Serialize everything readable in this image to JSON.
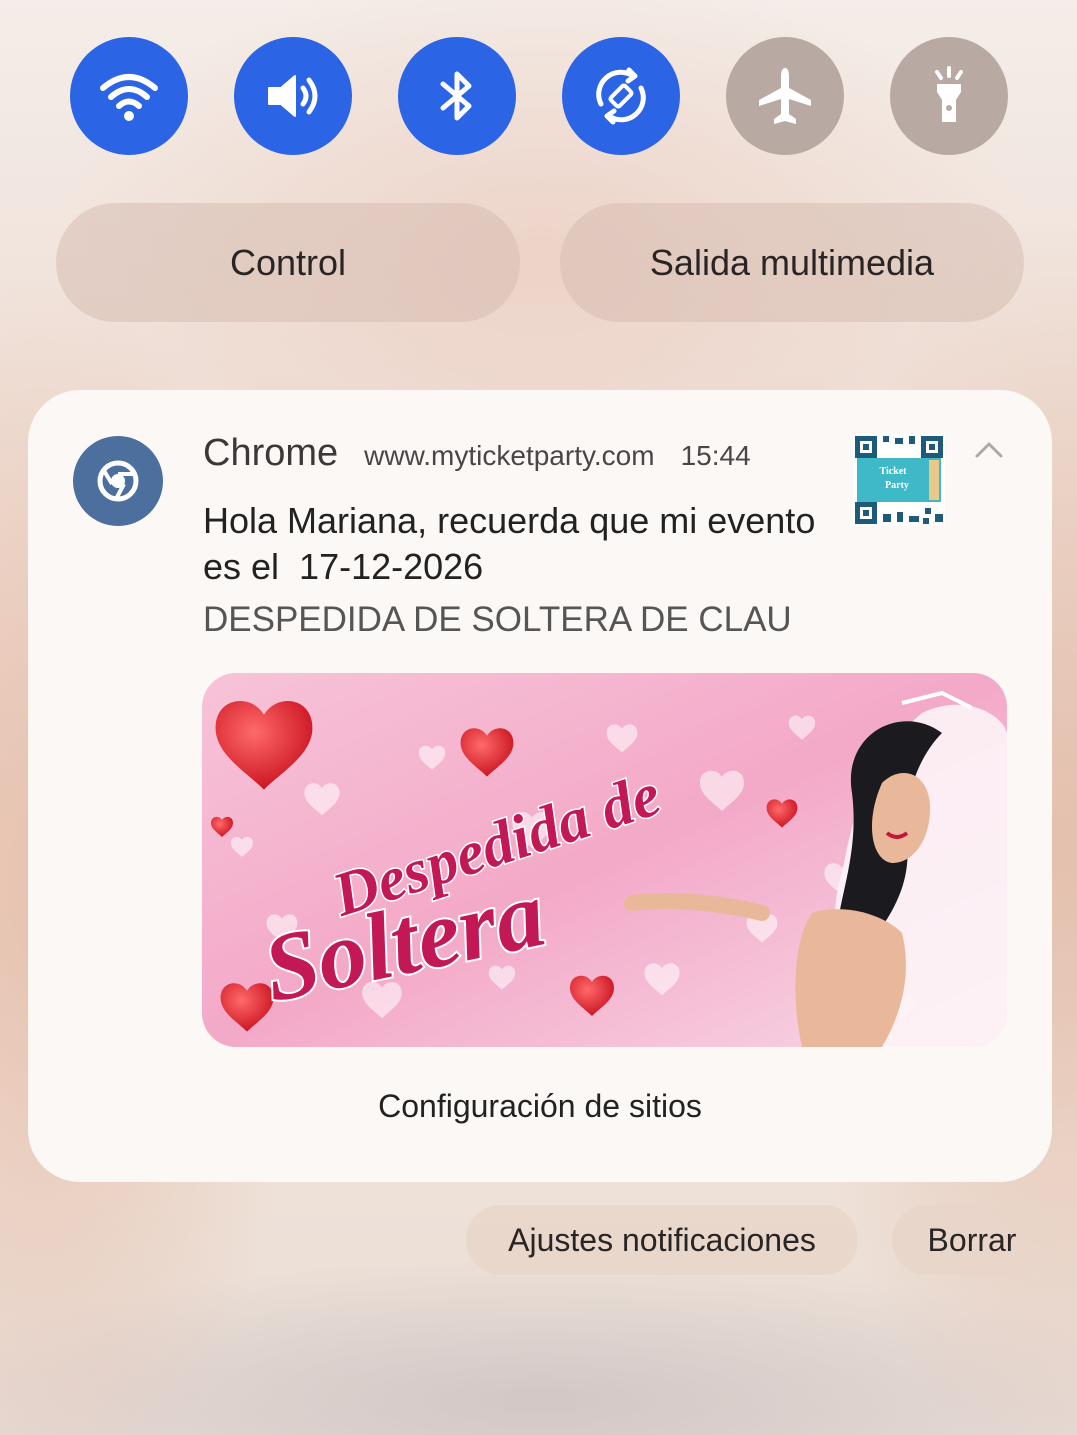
{
  "quick_settings": [
    {
      "name": "wifi",
      "icon": "wifi-icon",
      "state": "on"
    },
    {
      "name": "sound",
      "icon": "volume-icon",
      "state": "on"
    },
    {
      "name": "bluetooth",
      "icon": "bluetooth-icon",
      "state": "on"
    },
    {
      "name": "auto-rotate",
      "icon": "rotate-icon",
      "state": "on"
    },
    {
      "name": "airplane-mode",
      "icon": "airplane-icon",
      "state": "off"
    },
    {
      "name": "flashlight",
      "icon": "flashlight-icon",
      "state": "off"
    }
  ],
  "pills": {
    "control_label": "Control",
    "media_output_label": "Salida multimedia"
  },
  "notification": {
    "app_name": "Chrome",
    "site": "www.myticketparty.com",
    "time": "15:44",
    "title": "Hola Mariana, recuerda que mi evento es el  17-12-2026",
    "subtitle": "DESPEDIDA DE SOLTERA DE CLAU",
    "banner": {
      "line1": "Despedida de",
      "line2": "Soltera"
    },
    "thumbnail": {
      "line1": "Ticket",
      "line2": "Party"
    },
    "site_settings_label": "Configuración de sitios"
  },
  "footer": {
    "notification_settings_label": "Ajustes notificaciones",
    "clear_label": "Borrar"
  },
  "colors": {
    "toggle_on": "#2c64e6",
    "toggle_off": "#b8aaa2",
    "chrome_badge": "#4d6f9e"
  }
}
